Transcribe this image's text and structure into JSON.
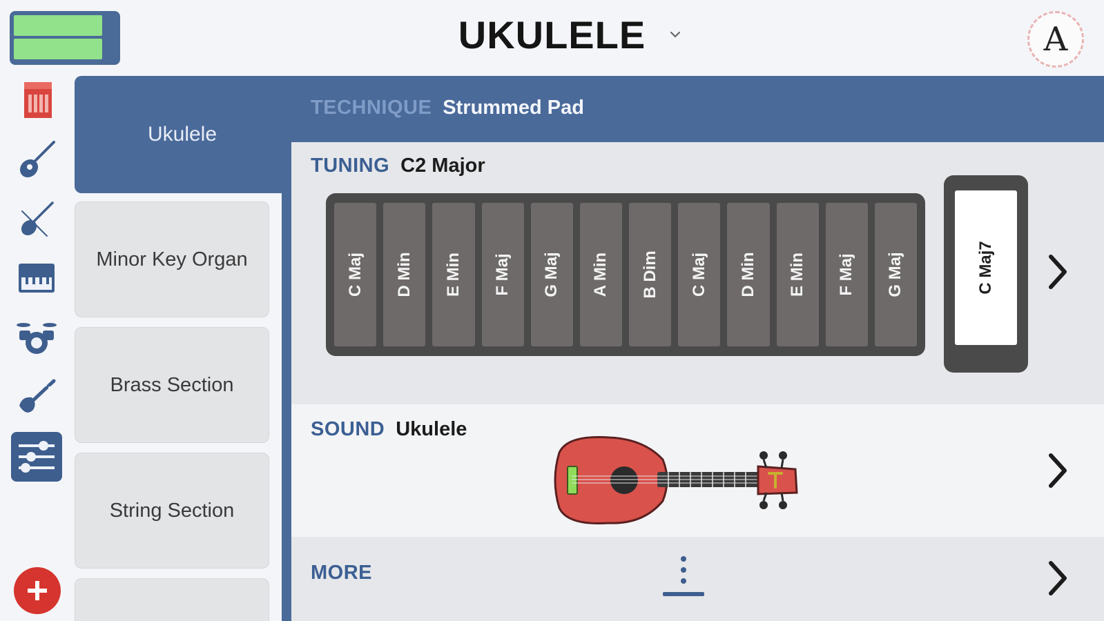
{
  "header": {
    "title": "UKULELE",
    "avatar_letter": "A",
    "icons": [
      "mini-panel-icon",
      "chevron-down-icon",
      "avatar-logo"
    ]
  },
  "rail": {
    "icons": [
      "keyboard-book-icon",
      "acoustic-guitar-icon",
      "violin-icon",
      "piano-icon",
      "drums-icon",
      "electric-guitar-icon",
      "mixer-icon",
      "add-icon"
    ]
  },
  "presets": {
    "active": "Ukulele",
    "items": [
      "Minor Key Organ",
      "Brass Section",
      "String Section"
    ]
  },
  "technique": {
    "label": "TECHNIQUE",
    "value": "Strummed Pad"
  },
  "tuning": {
    "label": "TUNING",
    "value": "C2 Major",
    "chords": [
      "C Maj",
      "D Min",
      "E Min",
      "F Maj",
      "G Maj",
      "A Min",
      "B Dim",
      "C Maj",
      "D Min",
      "E Min",
      "F Maj",
      "G Maj"
    ],
    "selected_chord": "C Maj7"
  },
  "sound": {
    "label": "SOUND",
    "value": "Ukulele"
  },
  "more": {
    "label": "MORE"
  },
  "colors": {
    "accent_blue": "#4a6a9a",
    "add_red": "#d6342e",
    "ukulele_red": "#d9524b",
    "panel_green": "#91e28a"
  }
}
